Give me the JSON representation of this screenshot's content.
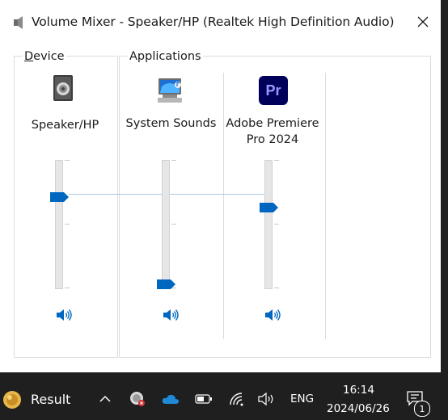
{
  "window": {
    "title": "Volume Mixer - Speaker/HP (Realtek High Definition Audio)",
    "icon": "speaker-icon",
    "close_icon": "close-icon"
  },
  "device_group": {
    "label": "Device",
    "channel": {
      "name": "Speaker/HP",
      "icon": "speaker-device-icon",
      "volume_percent": 73,
      "mute_icon": "speaker-volume-icon"
    }
  },
  "apps_group": {
    "label": "Applications",
    "channels": [
      {
        "name": "System Sounds",
        "icon": "system-sounds-icon",
        "volume_percent": 0,
        "mute_icon": "speaker-volume-icon"
      },
      {
        "name_line1": "Adobe Premiere",
        "name_line2": "Pro 2024",
        "icon": "premiere-pro-icon",
        "icon_text": "Pr",
        "volume_percent": 64,
        "mute_icon": "speaker-volume-icon"
      }
    ]
  },
  "taskbar": {
    "weather_label": "Result",
    "time": "16:14",
    "date": "2024/06/26",
    "language": "ENG",
    "notification_count": "1",
    "icons": [
      "chevron-up-icon",
      "antivirus-icon",
      "onedrive-cloud-icon",
      "battery-icon",
      "wifi-icon",
      "volume-icon",
      "notification-icon"
    ]
  },
  "colors": {
    "accent": "#0067c0",
    "premiere_bg": "#00005b",
    "premiere_fg": "#9999ff"
  }
}
